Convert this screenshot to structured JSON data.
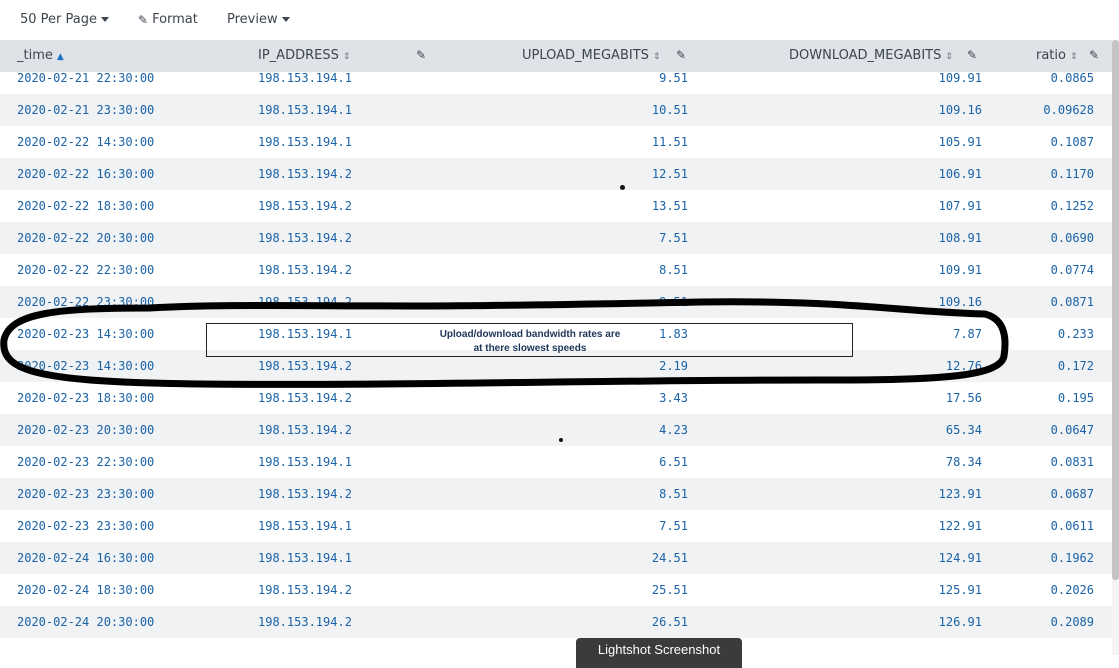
{
  "toolbar": {
    "per_page_label": "50 Per Page",
    "format_label": "Format",
    "preview_label": "Preview"
  },
  "columns": {
    "time": "_time",
    "ip": "IP_ADDRESS",
    "upload": "UPLOAD_MEGABITS",
    "download": "DOWNLOAD_MEGABITS",
    "ratio": "ratio"
  },
  "rows": [
    {
      "time": "2020-02-21 22:30:00",
      "ip": "198.153.194.1",
      "upload": "9.51",
      "download": "109.91",
      "ratio": "0.0865"
    },
    {
      "time": "2020-02-21 23:30:00",
      "ip": "198.153.194.1",
      "upload": "10.51",
      "download": "109.16",
      "ratio": "0.09628"
    },
    {
      "time": "2020-02-22 14:30:00",
      "ip": "198.153.194.1",
      "upload": "11.51",
      "download": "105.91",
      "ratio": "0.1087"
    },
    {
      "time": "2020-02-22 16:30:00",
      "ip": "198.153.194.2",
      "upload": "12.51",
      "download": "106.91",
      "ratio": "0.1170"
    },
    {
      "time": "2020-02-22 18:30:00",
      "ip": "198.153.194.2",
      "upload": "13.51",
      "download": "107.91",
      "ratio": "0.1252"
    },
    {
      "time": "2020-02-22 20:30:00",
      "ip": "198.153.194.2",
      "upload": "7.51",
      "download": "108.91",
      "ratio": "0.0690"
    },
    {
      "time": "2020-02-22 22:30:00",
      "ip": "198.153.194.2",
      "upload": "8.51",
      "download": "109.91",
      "ratio": "0.0774"
    },
    {
      "time": "2020-02-22 23:30:00",
      "ip": "198.153.194.2",
      "upload": "9.51",
      "download": "109.16",
      "ratio": "0.0871"
    },
    {
      "time": "2020-02-23 14:30:00",
      "ip": "198.153.194.1",
      "upload": "1.83",
      "download": "7.87",
      "ratio": "0.233"
    },
    {
      "time": "2020-02-23 14:30:00",
      "ip": "198.153.194.2",
      "upload": "2.19",
      "download": "12.76",
      "ratio": "0.172"
    },
    {
      "time": "2020-02-23 18:30:00",
      "ip": "198.153.194.2",
      "upload": "3.43",
      "download": "17.56",
      "ratio": "0.195"
    },
    {
      "time": "2020-02-23 20:30:00",
      "ip": "198.153.194.2",
      "upload": "4.23",
      "download": "65.34",
      "ratio": "0.0647"
    },
    {
      "time": "2020-02-23 22:30:00",
      "ip": "198.153.194.1",
      "upload": "6.51",
      "download": "78.34",
      "ratio": "0.0831"
    },
    {
      "time": "2020-02-23 23:30:00",
      "ip": "198.153.194.2",
      "upload": "8.51",
      "download": "123.91",
      "ratio": "0.0687"
    },
    {
      "time": "2020-02-23 23:30:00",
      "ip": "198.153.194.1",
      "upload": "7.51",
      "download": "122.91",
      "ratio": "0.0611"
    },
    {
      "time": "2020-02-24 16:30:00",
      "ip": "198.153.194.1",
      "upload": "24.51",
      "download": "124.91",
      "ratio": "0.1962"
    },
    {
      "time": "2020-02-24 18:30:00",
      "ip": "198.153.194.2",
      "upload": "25.51",
      "download": "125.91",
      "ratio": "0.2026"
    },
    {
      "time": "2020-02-24 20:30:00",
      "ip": "198.153.194.2",
      "upload": "26.51",
      "download": "126.91",
      "ratio": "0.2089"
    }
  ],
  "annotation": {
    "line1": "Upload/download bandwidth rates are",
    "line2": "at there slowest speeds"
  },
  "lightshot_label": "Lightshot Screenshot",
  "icons": {
    "pencil": "pencil-icon",
    "sort": "sort-icon",
    "sort_asc": "sort-ascending-icon",
    "caret": "caret-down-icon"
  },
  "colors": {
    "header_bg": "#dfe3e8",
    "row_alt_bg": "#f0f2f4",
    "cell_text": "#1a63a8",
    "accent": "#1a73c8"
  }
}
